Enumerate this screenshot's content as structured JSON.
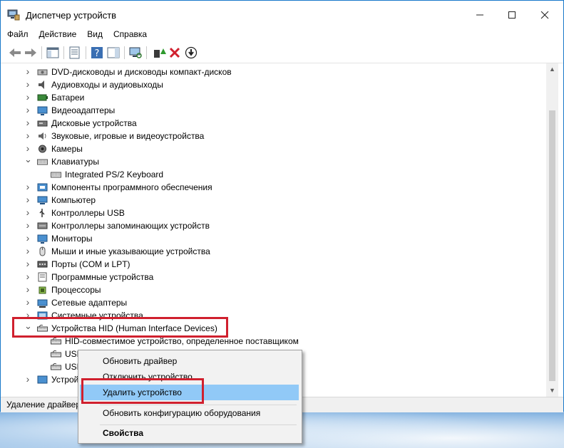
{
  "window": {
    "title": "Диспетчер устройств"
  },
  "menu": [
    "Файл",
    "Действие",
    "Вид",
    "Справка"
  ],
  "tree": [
    {
      "label": "DVD-дисководы и дисководы компакт-дисков",
      "expanded": false,
      "icon": "dvd-drive-icon",
      "level": 0
    },
    {
      "label": "Аудиовходы и аудиовыходы",
      "expanded": false,
      "icon": "audio-io-icon",
      "level": 0
    },
    {
      "label": "Батареи",
      "expanded": false,
      "icon": "battery-icon",
      "level": 0
    },
    {
      "label": "Видеоадаптеры",
      "expanded": false,
      "icon": "display-adapter-icon",
      "level": 0
    },
    {
      "label": "Дисковые устройства",
      "expanded": false,
      "icon": "disk-drive-icon",
      "level": 0
    },
    {
      "label": "Звуковые, игровые и видеоустройства",
      "expanded": false,
      "icon": "speaker-icon",
      "level": 0
    },
    {
      "label": "Камеры",
      "expanded": false,
      "icon": "camera-icon",
      "level": 0
    },
    {
      "label": "Клавиатуры",
      "expanded": true,
      "icon": "keyboard-icon",
      "level": 0
    },
    {
      "label": "Integrated PS/2 Keyboard",
      "expanded": null,
      "icon": "keyboard-icon",
      "level": 1
    },
    {
      "label": "Компоненты программного обеспечения",
      "expanded": false,
      "icon": "software-component-icon",
      "level": 0
    },
    {
      "label": "Компьютер",
      "expanded": false,
      "icon": "computer-icon",
      "level": 0
    },
    {
      "label": "Контроллеры USB",
      "expanded": false,
      "icon": "usb-icon",
      "level": 0
    },
    {
      "label": "Контроллеры запоминающих устройств",
      "expanded": false,
      "icon": "storage-controller-icon",
      "level": 0
    },
    {
      "label": "Мониторы",
      "expanded": false,
      "icon": "monitor-icon",
      "level": 0
    },
    {
      "label": "Мыши и иные указывающие устройства",
      "expanded": false,
      "icon": "mouse-icon",
      "level": 0
    },
    {
      "label": "Порты (COM и LPT)",
      "expanded": false,
      "icon": "port-icon",
      "level": 0
    },
    {
      "label": "Программные устройства",
      "expanded": false,
      "icon": "software-device-icon",
      "level": 0
    },
    {
      "label": "Процессоры",
      "expanded": false,
      "icon": "processor-icon",
      "level": 0
    },
    {
      "label": "Сетевые адаптеры",
      "expanded": false,
      "icon": "network-adapter-icon",
      "level": 0
    },
    {
      "label": "Системные устройства",
      "expanded": false,
      "icon": "system-device-icon",
      "level": 0
    },
    {
      "label": "Устройства HID (Human Interface Devices)",
      "expanded": true,
      "icon": "hid-icon",
      "level": 0
    },
    {
      "label": "HID-совместимое устройство, определенное поставщиком",
      "expanded": null,
      "icon": "hid-icon",
      "level": 1
    },
    {
      "label": "USB",
      "expanded": null,
      "icon": "hid-icon",
      "level": 1
    },
    {
      "label": "USB",
      "expanded": null,
      "icon": "hid-icon",
      "level": 1
    },
    {
      "label": "Устрой",
      "expanded": false,
      "icon": "device-icon",
      "level": 0
    }
  ],
  "status": "Удаление драйвер",
  "context_menu": {
    "items": [
      {
        "label": "Обновить драйвер",
        "bold": false,
        "highlighted": false
      },
      {
        "label": "Отключить устройство",
        "bold": false,
        "highlighted": false
      },
      {
        "label": "Удалить устройство",
        "bold": false,
        "highlighted": true
      },
      {
        "label": "Обновить конфигурацию оборудования",
        "bold": false,
        "highlighted": false
      },
      {
        "label": "Свойства",
        "bold": true,
        "highlighted": false
      }
    ]
  },
  "colors": {
    "accent": "#1979ca",
    "highlight_box": "#d0202e",
    "menu_hover": "#91c9f7"
  }
}
